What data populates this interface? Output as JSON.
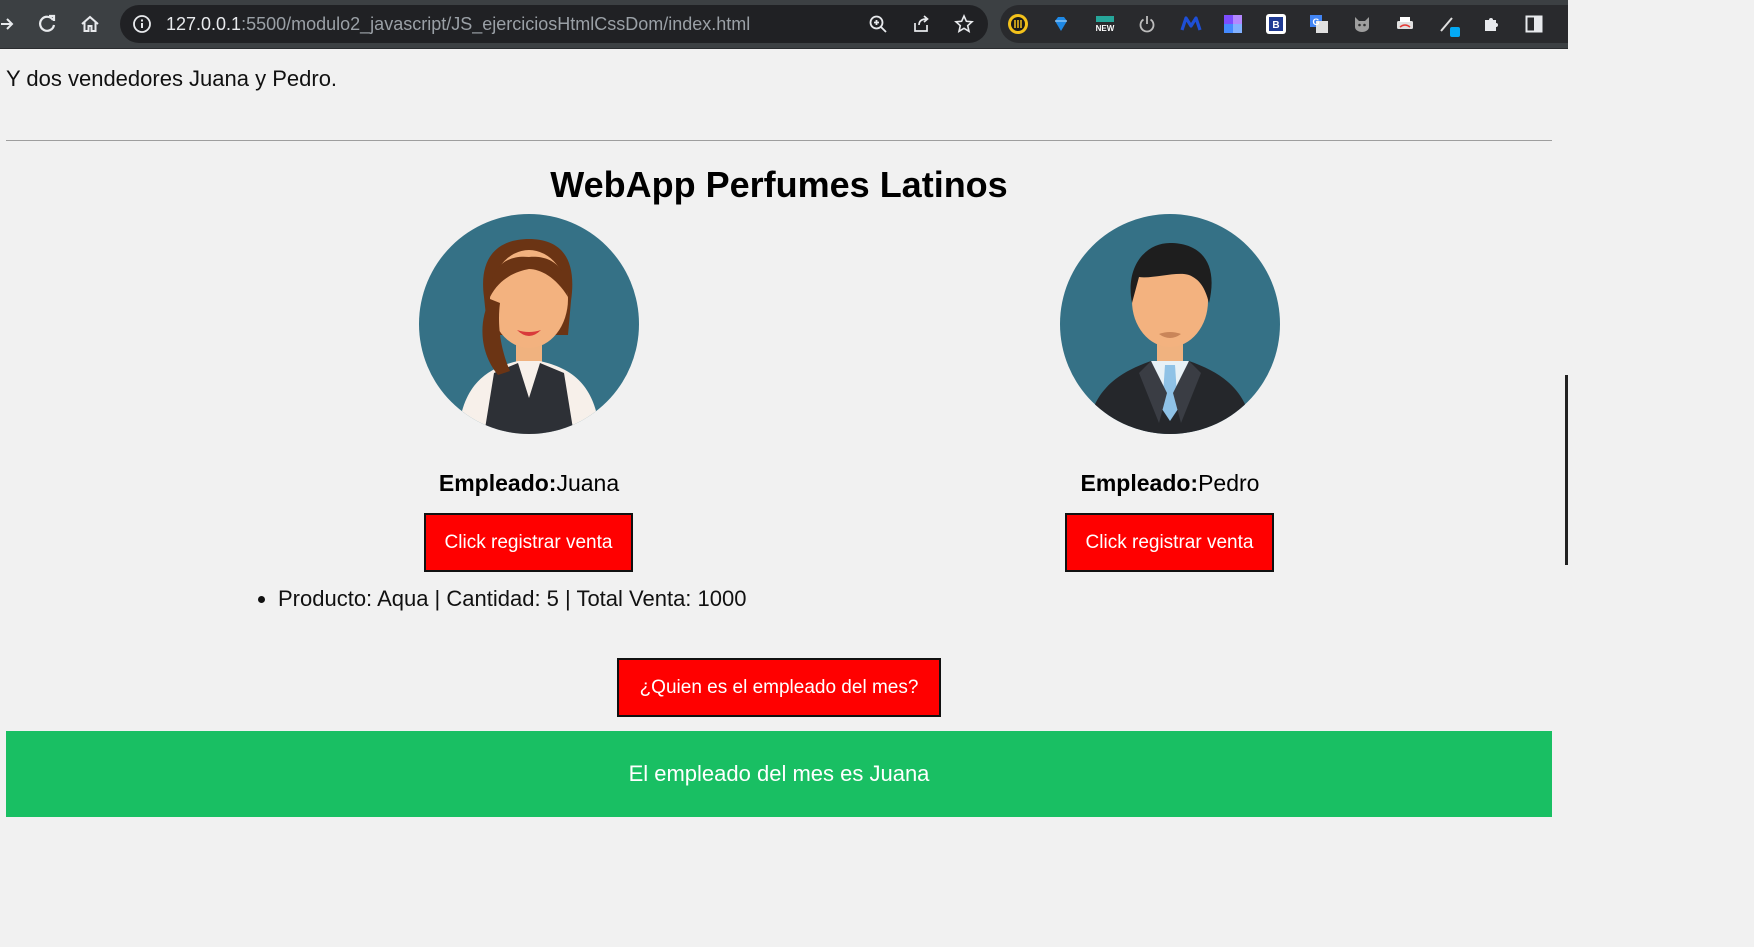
{
  "browser": {
    "url_host": "127.0.0.1",
    "url_rest": ":5500/modulo2_javascript/JS_ejerciciosHtmlCssDom/index.html",
    "extensions": [
      "ext-1",
      "ext-diamond",
      "ext-new",
      "ext-power",
      "ext-m",
      "ext-grid",
      "ext-b",
      "ext-translate",
      "ext-cat",
      "ext-printer",
      "ext-pen",
      "ext-puzzle",
      "ext-sidepanel"
    ]
  },
  "page": {
    "intro_text": "Y dos vendedores Juana y Pedro.",
    "title": "WebApp Perfumes Latinos",
    "employees": [
      {
        "label": "Empleado:",
        "name": "Juana",
        "button": "Click registrar venta"
      },
      {
        "label": "Empleado:",
        "name": "Pedro",
        "button": "Click registrar venta"
      }
    ],
    "sales": [
      "Producto: Aqua | Cantidad: 5 | Total Venta: 1000"
    ],
    "month_button": "¿Quien es el empleado del mes?",
    "result_banner": "El empleado del mes es Juana"
  },
  "colors": {
    "button_red": "#ff0000",
    "banner_green": "#19bf63",
    "page_bg": "#f1f1f1",
    "avatar_bg": "#357186"
  }
}
